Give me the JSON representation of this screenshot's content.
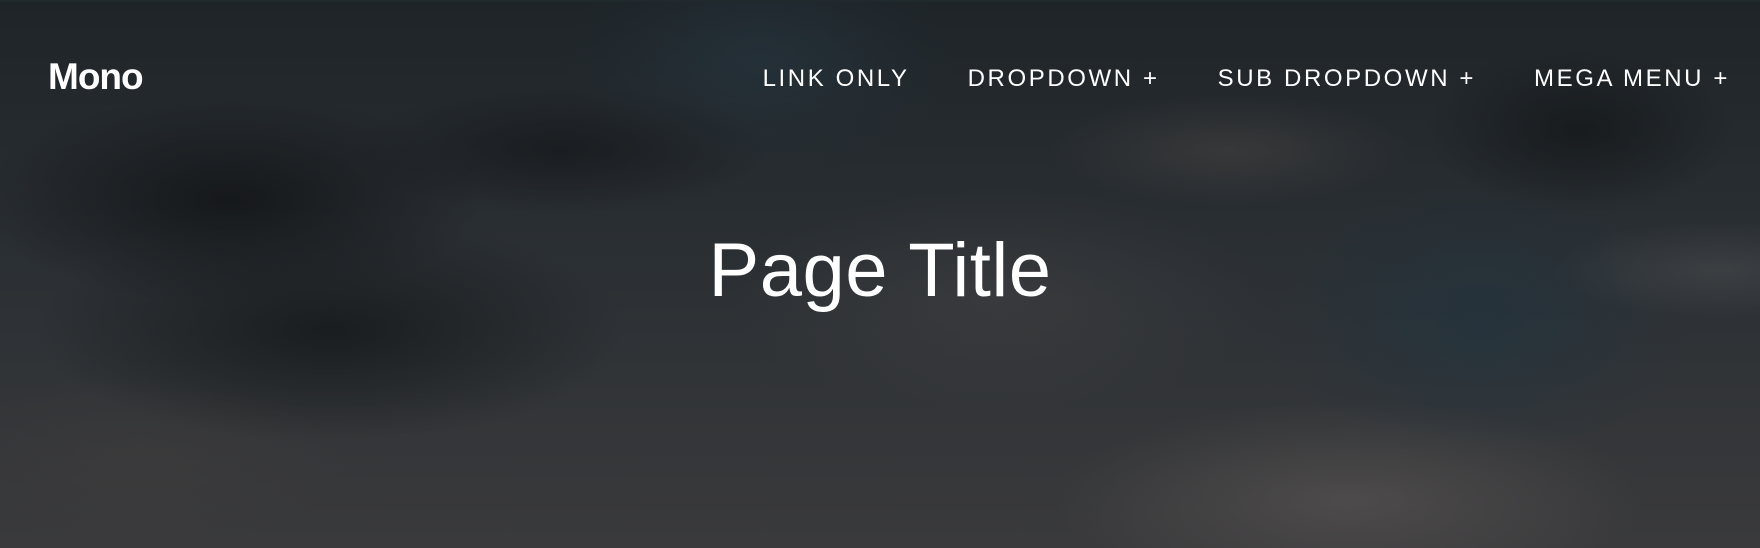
{
  "header": {
    "logo": "Mono",
    "nav": [
      {
        "label": "LINK ONLY"
      },
      {
        "label": "DROPDOWN +"
      },
      {
        "label": "SUB DROPDOWN +"
      },
      {
        "label": "MEGA MENU +"
      }
    ]
  },
  "hero": {
    "title": "Page Title"
  },
  "colors": {
    "text": "#ffffff",
    "background_dark": "#1e2428",
    "background_light": "#3a3a3c"
  }
}
